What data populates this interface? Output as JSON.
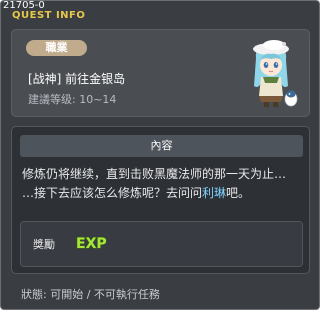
{
  "header": {
    "quest_id": "21705-0",
    "title": "QUEST INFO"
  },
  "quest": {
    "job_badge": "職業",
    "name": "[战神] 前往金银岛",
    "recommended_level": "建議等级: 10~14"
  },
  "content": {
    "header": "內容",
    "line1": "修炼仍将继续，直到击败黑魔法师的那一天为止…",
    "line2_prefix": "…接下去应该怎么修炼呢？去问问",
    "npc_name": "利琳",
    "line2_suffix": "吧。"
  },
  "reward": {
    "label": "獎勵",
    "exp_text": "EXP"
  },
  "status": "狀態: 可開始 / 不可執行任務",
  "colors": {
    "window_bg": "#3a3d42",
    "title_yellow": "#e6c84a",
    "badge": "#c0ab8d",
    "npc_name": "#7fd3ff",
    "exp_green": "#a8e63a"
  },
  "icons": {
    "npc": "npc-portrait-icon",
    "exp": "exp-icon"
  }
}
